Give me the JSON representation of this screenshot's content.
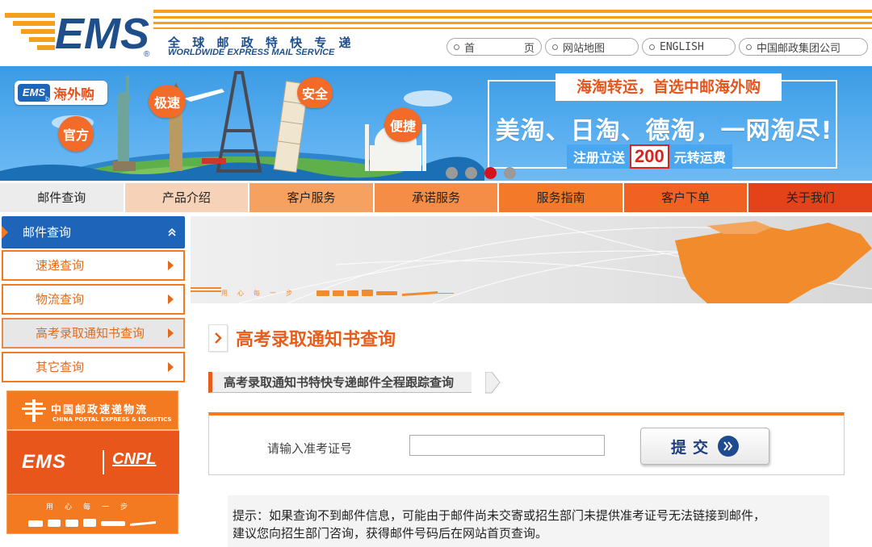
{
  "header": {
    "logo_text": "EMS",
    "brand_cn": "全 球 邮 政 特 快 专 递",
    "brand_en": "WORLDWIDE EXPRESS MAIL SERVICE",
    "links": {
      "home_a": "首",
      "home_b": "页",
      "sitemap": "网站地图",
      "english": "ENGLISH",
      "group": "中国邮政集团公司"
    }
  },
  "banner": {
    "shop_badge": "EMS",
    "shop_name": "海外购",
    "shop_url": "buy.ems.com.cn",
    "bubbles": [
      "官方",
      "极速",
      "安全",
      "便捷"
    ],
    "promo_line1": "海淘转运，首选中邮海外购",
    "promo_line2": "美淘、日淘、德淘，一网淘尽!",
    "promo_line3_pre": "注册立送",
    "promo_amount": "200",
    "promo_line3_post": "元转运费",
    "dots_total": 4,
    "dots_active": 2
  },
  "nav": {
    "items": [
      {
        "label": "邮件查询",
        "color": "#ececec"
      },
      {
        "label": "产品介绍",
        "color": "#f6d2b8"
      },
      {
        "label": "客户服务",
        "color": "#f6a160"
      },
      {
        "label": "承诺服务",
        "color": "#f68d46"
      },
      {
        "label": "服务指南",
        "color": "#f47a2a"
      },
      {
        "label": "客户下单",
        "color": "#f16121"
      },
      {
        "label": "关于我们",
        "color": "#e4431a"
      }
    ]
  },
  "sidebar": {
    "head": "邮件查询",
    "items": [
      {
        "label": "速递查询"
      },
      {
        "label": "物流查询"
      },
      {
        "label": "高考录取通知书查询"
      },
      {
        "label": "其它查询"
      }
    ],
    "logo": {
      "cn": "中国邮政速递物流",
      "en": "CHINA POSTAL EXPRESS & LOGISTICS",
      "ems": "EMS",
      "cnpl": "CNPL",
      "slogan": "用心每一步"
    }
  },
  "main": {
    "banner_slogan": "用心每一步",
    "title": "高考录取通知书查询",
    "subtitle": "高考录取通知书特快专递邮件全程跟踪查询",
    "query": {
      "label": "请输入准考证号",
      "value": "",
      "submit": "提交"
    },
    "tip_line1": "提示：如果查询不到邮件信息，可能由于邮件尚未交寄或招生部门未提供准考证号无法链接到邮件，",
    "tip_line2": "建议您向招生部门咨询，获得邮件号码后在网站首页查询。"
  },
  "colors": {
    "ems_blue": "#1f4f8b",
    "ems_orange": "#f47a22",
    "title_orange": "#e85d1a",
    "sidebar_blue": "#1e64b8"
  }
}
